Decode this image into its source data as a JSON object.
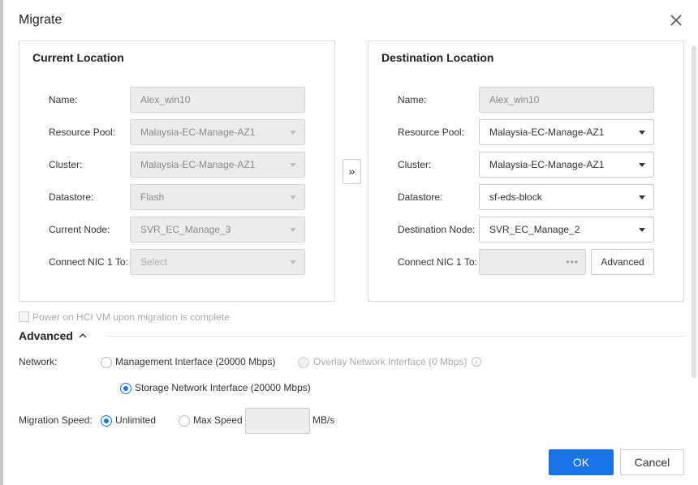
{
  "dialog": {
    "title": "Migrate",
    "close_icon": "close-icon"
  },
  "current": {
    "title": "Current Location",
    "name_label": "Name:",
    "name_value": "Alex_win10",
    "pool_label": "Resource Pool:",
    "pool_value": "Malaysia-EC-Manage-AZ1",
    "cluster_label": "Cluster:",
    "cluster_value": "Malaysia-EC-Manage-AZ1",
    "datastore_label": "Datastore:",
    "datastore_value": "Flash",
    "node_label": "Current Node:",
    "node_value": "SVR_EC_Manage_3",
    "nic_label": "Connect NIC 1 To:",
    "nic_placeholder": "Select"
  },
  "move_icon": "»",
  "destination": {
    "title": "Destination Location",
    "name_label": "Name:",
    "name_value": "Alex_win10",
    "pool_label": "Resource Pool:",
    "pool_value": "Malaysia-EC-Manage-AZ1",
    "cluster_label": "Cluster:",
    "cluster_value": "Malaysia-EC-Manage-AZ1",
    "datastore_label": "Datastore:",
    "datastore_value": "sf-eds-block",
    "node_label": "Destination Node:",
    "node_value": "SVR_EC_Manage_2",
    "nic_label": "Connect NIC 1 To:",
    "nic_dots": "•••",
    "advanced_button": "Advanced"
  },
  "power_on_label": "Power on HCI VM upon migration is complete",
  "advanced": {
    "heading": "Advanced",
    "network_label": "Network:",
    "network_options": [
      "Management Interface (20000 Mbps)",
      "Overlay Network Interface (0 Mbps)",
      "Storage Network Interface (20000 Mbps)"
    ],
    "info_glyph": "i",
    "speed_label": "Migration Speed:",
    "speed_options": [
      "Unlimited",
      "Max Speed"
    ],
    "speed_unit": "MB/s"
  },
  "buttons": {
    "ok": "OK",
    "cancel": "Cancel"
  },
  "colors": {
    "accent": "#1a73e8"
  }
}
